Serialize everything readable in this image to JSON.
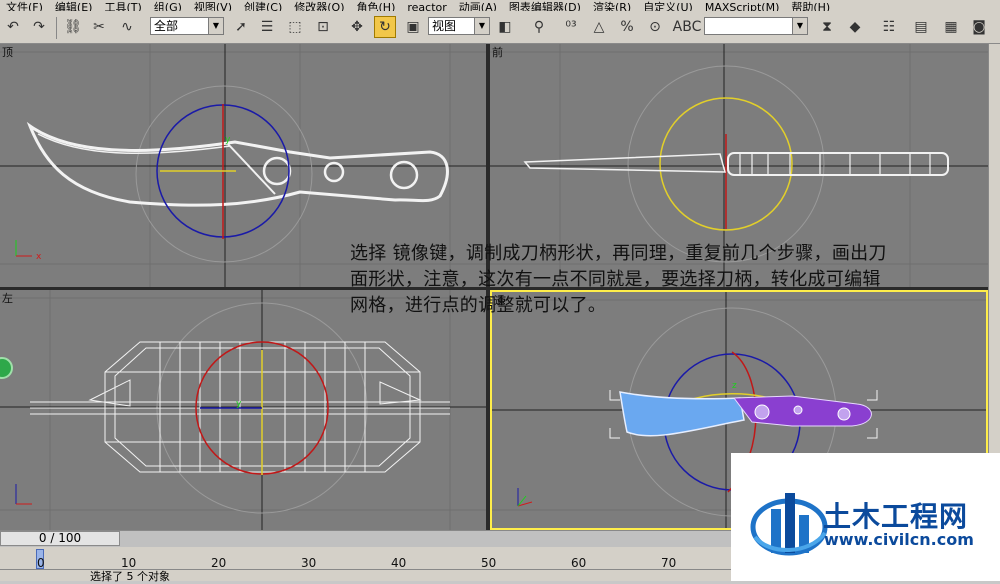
{
  "menu": [
    "文件(F)",
    "编辑(E)",
    "工具(T)",
    "组(G)",
    "视图(V)",
    "创建(C)",
    "修改器(O)",
    "角色(H)",
    "reactor",
    "动画(A)",
    "图表编辑器(D)",
    "渲染(R)",
    "自定义(U)",
    "MAXScript(M)",
    "帮助(H)"
  ],
  "toolbar": {
    "selection_filter": "全部",
    "reference_coord": "视图",
    "named_selection": ""
  },
  "viewports": {
    "top_label": "顶",
    "front_label": "前",
    "left_label": "左",
    "perspective_label": "透"
  },
  "overlay_text": {
    "line1": "选择 镜像键，调制成刀柄形状，再同理，重复前几个步骤，画出刀",
    "line2": "面形状，注意，这次有一点不同就是，要选择刀柄，转化成可编辑",
    "line3": "网格，进行点的调整就可以了。"
  },
  "timeline": {
    "frame_display": "0 / 100",
    "ticks": [
      "0",
      "10",
      "20",
      "30",
      "40",
      "50",
      "60",
      "70"
    ]
  },
  "status": {
    "text": "选择了 5 个对象"
  },
  "watermark": {
    "main": "土木工程网",
    "url": "www.civilcn.com"
  },
  "colors": {
    "viewport_bg": "#7d7d7d",
    "active_border": "#ffee4a",
    "gizmo_blue": "#1a1aa8",
    "gizmo_yellow": "#e2cf2a",
    "gizmo_red": "#c01818",
    "handle_purple": "#8a3fd0",
    "blade_blue": "#6aa8f0"
  }
}
